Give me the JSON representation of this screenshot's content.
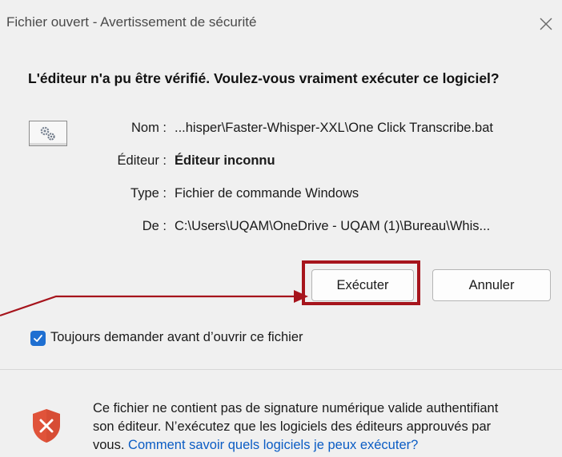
{
  "window": {
    "title": "Fichier ouvert - Avertissement de sécurité"
  },
  "heading": "L'éditeur n'a pu être vérifié. Voulez-vous vraiment exécuter ce logiciel?",
  "details": {
    "name_label": "Nom :",
    "name_value": "...hisper\\Faster-Whisper-XXL\\One Click Transcribe.bat",
    "publisher_label": "Éditeur :",
    "publisher_value": "Éditeur inconnu",
    "type_label": "Type :",
    "type_value": "Fichier de commande Windows",
    "from_label": "De :",
    "from_value": "C:\\Users\\UQAM\\OneDrive - UQAM (1)\\Bureau\\Whis..."
  },
  "buttons": {
    "run": "Exécuter",
    "cancel": "Annuler"
  },
  "checkbox": {
    "label": "Toujours demander avant d’ouvrir ce fichier",
    "checked": true
  },
  "footer": {
    "line1": "Ce fichier ne contient pas de signature numérique valide authentifiant",
    "line2": "son éditeur. N’exécutez que les logiciels des éditeurs approuvés par",
    "line3_prefix": "vous.",
    "link": "Comment savoir quels logiciels je peux exécuter?"
  },
  "colors": {
    "accent": "#1f6fd1",
    "highlight": "#a6141c",
    "link": "#0b5cc4",
    "shield": "#e0533a"
  },
  "icons": {
    "close": "close-icon",
    "file": "batch-file-icon",
    "shield": "shield-warning-icon",
    "check": "checkmark-icon"
  }
}
